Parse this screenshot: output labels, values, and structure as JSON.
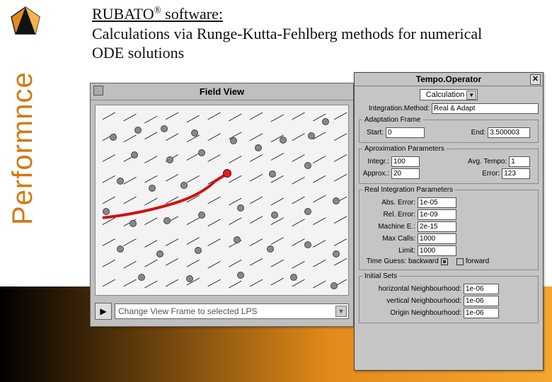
{
  "sidetext": "Performnce",
  "title_sw": "RUBATO",
  "title_reg": "®",
  "title_sw2": " software:",
  "title_rest": "Calculations via Runge-Kutta-Fehlberg methods for numerical ODE solutions",
  "fieldview": {
    "title": "Field View",
    "dropdown": "Change View Frame to selected LPS"
  },
  "tempo": {
    "title": "Tempo.Operator",
    "calculation": "Calculation",
    "integ_method_label": "Integration.Method:",
    "integ_method": "Real & Adapt",
    "adaptation_frame": "Adaptation Frame",
    "start_label": "Start:",
    "start": "0",
    "end_label": "End:",
    "end": "3.500003",
    "aprox_params": "Aproximation Parameters",
    "integr_label": "Integr.:",
    "integr": "100",
    "avgtempo_label": "Avg. Tempo:",
    "avgtempo": "1",
    "approx_label": "Approx.:",
    "approx": "20",
    "error_label": "Error:",
    "error": "123",
    "realint": "Real Integration Parameters",
    "abserr_label": "Abs. Error:",
    "abserr": "1e-05",
    "relerr_label": "Rel. Error:",
    "relerr": "1e-09",
    "mache_label": "Machine E.:",
    "mache": "2e-15",
    "maxcalls_label": "Max Calls:",
    "maxcalls": "1000",
    "limit_label": "Limit:",
    "limit": "1000",
    "timeguess_label": "Time Guess:",
    "timeguess_back": "backward",
    "timeguess_fwd": "forward",
    "initial_sets": "Initial Sets",
    "hn_label": "horizontal Neighbourhood:",
    "hn": "1e-06",
    "vn_label": "vertical Neighbourhood:",
    "vn": "1e-06",
    "on_label": "Origin Neighbourhood:",
    "on": "1e-06"
  }
}
